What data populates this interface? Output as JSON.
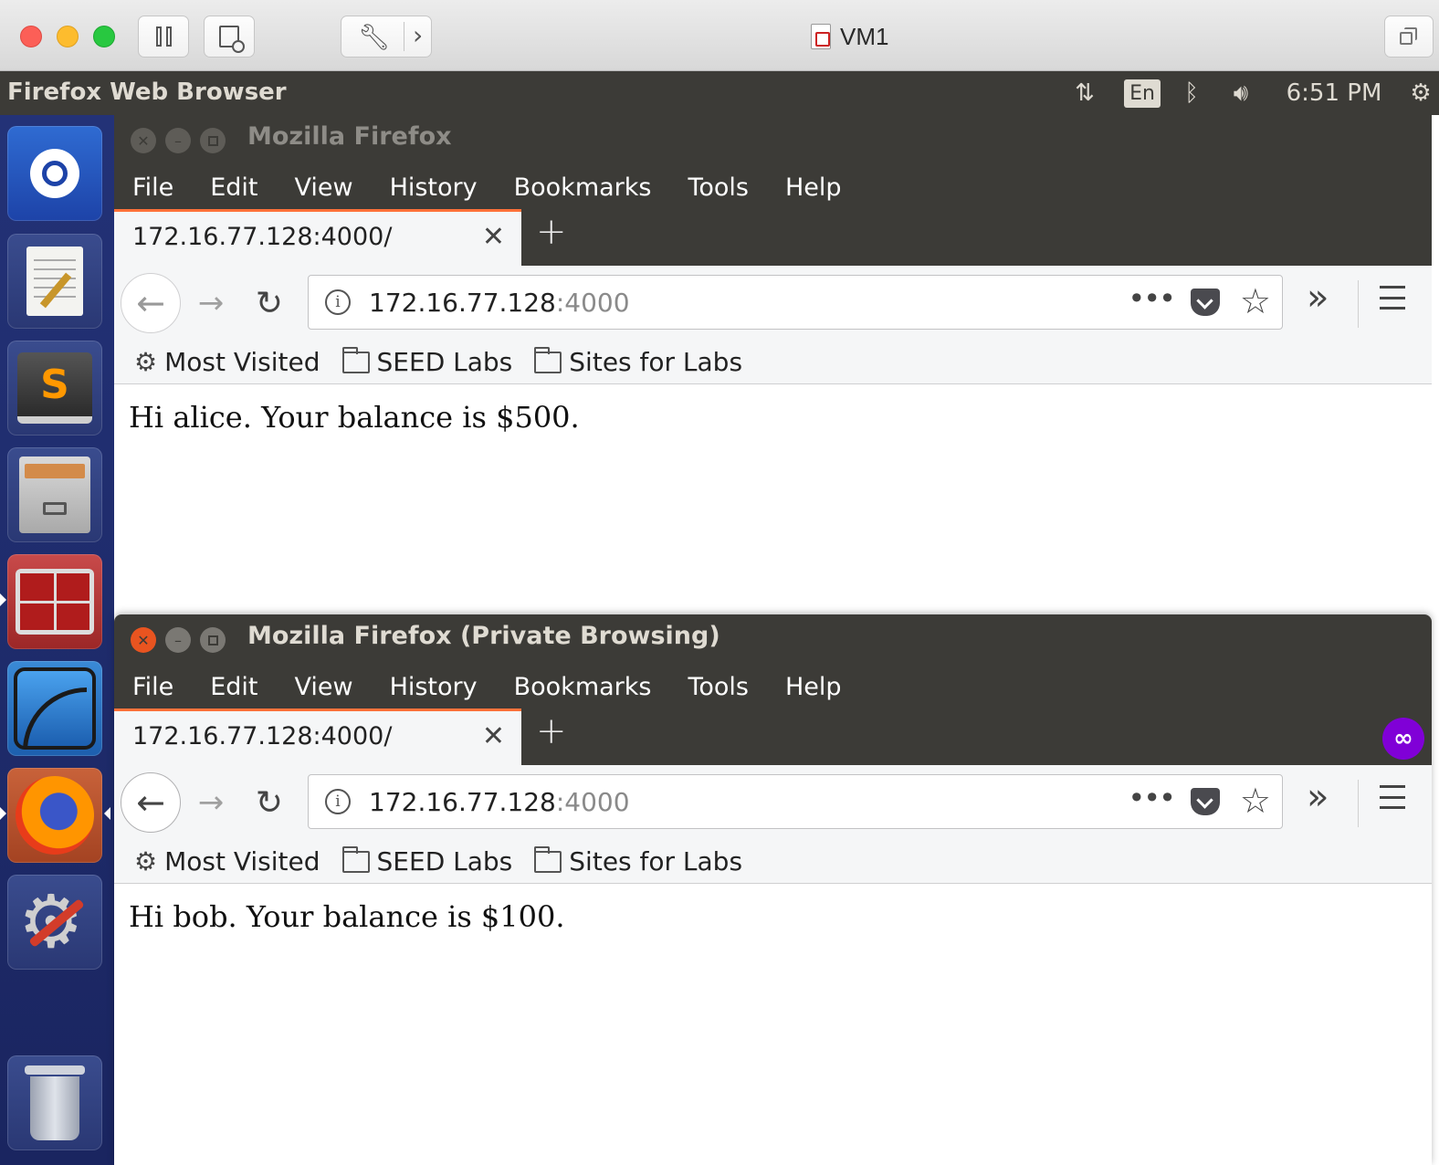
{
  "vm_window": {
    "title": "VM1",
    "icons": [
      "pause-icon",
      "snapshot-icon",
      "wrench-icon",
      "chevron-right-icon",
      "restore-window-icon"
    ]
  },
  "ubuntu_panel": {
    "app_title": "Firefox Web Browser",
    "language": "En",
    "time": "6:51 PM",
    "icons": [
      "network-transfer-icon",
      "bluetooth-icon",
      "volume-icon",
      "settings-gear-icon"
    ]
  },
  "launcher": {
    "items": [
      "ubuntu-dash-icon",
      "text-editor-icon",
      "sublime-text-icon",
      "file-manager-icon",
      "terminator-icon",
      "wireshark-icon",
      "firefox-icon",
      "system-settings-icon",
      "trash-icon"
    ]
  },
  "colors": {
    "firefox_dark": "#3c3b37",
    "tab_accent": "#ff7139",
    "private_purple": "#8000d7",
    "launcher_blue": "#1d2a6b",
    "close_red": "#e95420"
  },
  "menu": [
    "File",
    "Edit",
    "View",
    "History",
    "Bookmarks",
    "Tools",
    "Help"
  ],
  "bookmarks": [
    "Most Visited",
    "SEED Labs",
    "Sites for Labs"
  ],
  "windows": [
    {
      "title": "Mozilla Firefox",
      "tab_title": "172.16.77.128:4000/",
      "url_host": "172.16.77.128",
      "url_port": ":4000",
      "page_text": "Hi alice. Your balance is $500."
    },
    {
      "title": "Mozilla Firefox (Private Browsing)",
      "tab_title": "172.16.77.128:4000/",
      "url_host": "172.16.77.128",
      "url_port": ":4000",
      "page_text": "Hi bob. Your balance is $100."
    }
  ]
}
